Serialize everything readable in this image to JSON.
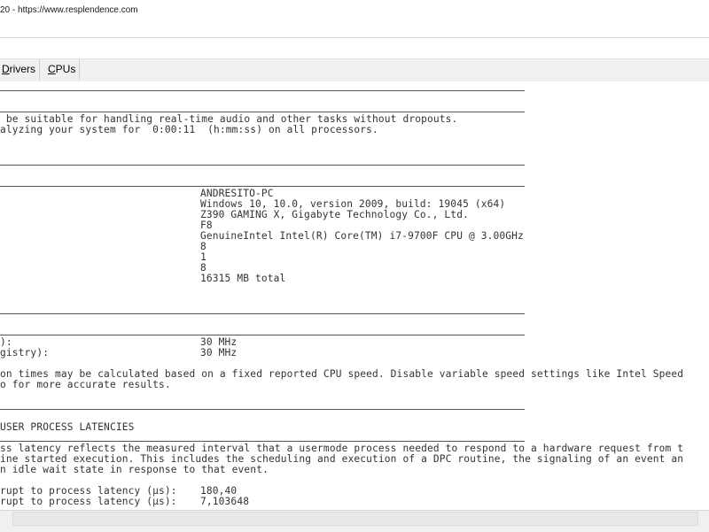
{
  "window": {
    "title": "20 - https://www.resplendence.com"
  },
  "tabs": [
    {
      "label": "Drivers",
      "accel": "D",
      "rest": "rivers"
    },
    {
      "label": "CPUs",
      "accel": "C",
      "rest": "PUs"
    }
  ],
  "report": {
    "intro_line1": " be suitable for handling real-time audio and other tasks without dropouts.",
    "intro_line2": "alyzing your system for  0:00:11  (h:mm:ss) on all processors.",
    "system": {
      "computer_name": "ANDRESITO-PC",
      "os": "Windows 10, 10.0, version 2009, build: 19045 (x64)",
      "motherboard": "Z390 GAMING X, Gigabyte Technology Co., Ltd.",
      "bios": "F8",
      "cpu": "GenuineIntel Intel(R) Core(TM) i7-9700F CPU @ 3.00GHz",
      "logical_processors": "8",
      "processor_groups": "1",
      "processors": "8",
      "memory": "16315 MB total"
    },
    "cpu_speed": {
      "label1": "):",
      "value1": "30 MHz",
      "label2": "gistry):",
      "value2": "30 MHz"
    },
    "note_line1": "on times may be calculated based on a fixed reported CPU speed. Disable variable speed settings like Intel Speed",
    "note_line2": "o for more accurate results.",
    "section_heading": "USER PROCESS LATENCIES",
    "desc_line1": "ss latency reflects the measured interval that a usermode process needed to respond to a hardware request from t",
    "desc_line2": "ine started execution. This includes the scheduling and execution of a DPC routine, the signaling of an event an",
    "desc_line3": "n idle wait state in response to that event.",
    "latency": {
      "max_label": "rupt to process latency (µs):",
      "max_value": "180,40",
      "avg_label": "rupt to process latency (µs):",
      "avg_value": "7,103648"
    }
  }
}
